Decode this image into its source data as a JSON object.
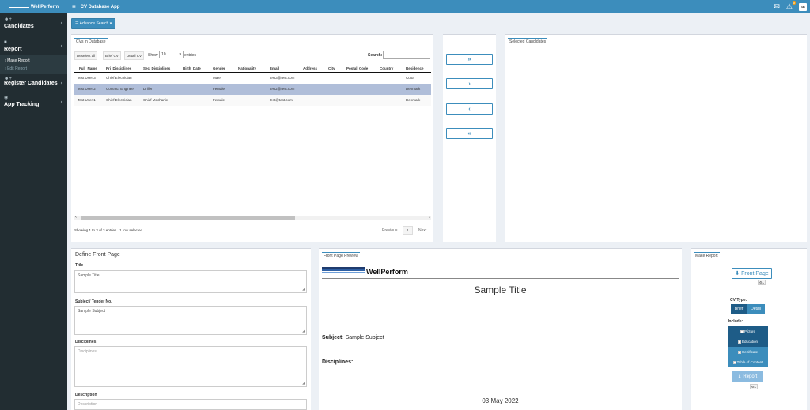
{
  "brand": {
    "logo_text": "WellPerform"
  },
  "header": {
    "app_title": "CV Database App",
    "notification_count": "0",
    "user_initials": "SB"
  },
  "sidebar": {
    "items": [
      {
        "label": "Candidates"
      },
      {
        "label": "Report",
        "subitems": [
          {
            "label": "Make Report"
          },
          {
            "label": "Edit Report"
          }
        ]
      },
      {
        "label": "Register Candidates"
      },
      {
        "label": "App Tracking"
      }
    ]
  },
  "toolbar": {
    "advance_search": "Advance Search"
  },
  "cv_database": {
    "tab": "CVs in Database",
    "deselect_all": "Deselect all",
    "brief_cv": "Brief CV",
    "detail_cv": "Detail CV",
    "show_label": "Show",
    "entries_value": "10",
    "entries_label": "entries",
    "search_label": "Search:",
    "columns": [
      "Full_Name",
      "Pri_Disciplines",
      "Sec_Disciplines",
      "Birth_Date",
      "Gender",
      "Nationality",
      "Email",
      "Address",
      "City",
      "Postal_Code",
      "Country",
      "Residence"
    ],
    "rows": [
      [
        "Test User 3",
        "Chief Electrician",
        "",
        "",
        "Male",
        "",
        "test3@test.com",
        "",
        "",
        "",
        "",
        "Cuba"
      ],
      [
        "Test User 2",
        "Contract Engineer",
        "Driller",
        "",
        "Female",
        "",
        "test2@test.com",
        "",
        "",
        "",
        "",
        "Denmark"
      ],
      [
        "Test User 1",
        "Chief Electrician",
        "Chief Mechanic",
        "",
        "Female",
        "",
        "test@test.com",
        "",
        "",
        "",
        "",
        "Denmark"
      ]
    ],
    "info": "Showing 1 to 3 of 3 entries",
    "selected_info": "1 row selected",
    "previous": "Previous",
    "page": "1",
    "next": "Next"
  },
  "transfer": {
    "add_all": "»",
    "add": "›",
    "remove": "‹",
    "remove_all": "«"
  },
  "selected_candidates": {
    "tab": "Selected Candidates"
  },
  "define_front_page": {
    "title": "Define Front Page",
    "fields": [
      {
        "label": "Title",
        "value": "Sample Title",
        "placeholder": ""
      },
      {
        "label": "Subject/ Tender No.",
        "value": "Sample Subject",
        "placeholder": ""
      },
      {
        "label": "Disciplines",
        "value": "",
        "placeholder": "Disciplines"
      },
      {
        "label": "Description",
        "value": "",
        "placeholder": "Description"
      }
    ]
  },
  "preview": {
    "tab": "Front Page Preview",
    "logo_text": "WellPerform",
    "title": "Sample Title",
    "subject_label": "Subject:",
    "subject_value": "Sample Subject",
    "disciplines_label": "Disciplines:",
    "date": "03 May 2022"
  },
  "make_report": {
    "tab": "Make Report",
    "front_page_button": "Front Page",
    "cv_type_label": "CV Type:",
    "cv_type_options": [
      "Brief",
      "Detail"
    ],
    "cv_type_selected": "Brief",
    "include_label": "Include:",
    "include_options": [
      {
        "label": "Picture",
        "checked": true
      },
      {
        "label": "Education",
        "checked": true
      },
      {
        "label": "Certificate",
        "checked": false
      },
      {
        "label": "Table of Content",
        "checked": false
      }
    ],
    "report_button": "Report"
  },
  "colors": {
    "primary": "#3c8dbc",
    "sidebar": "#222d32",
    "include_dark": "#1e5c87",
    "selected_row": "#b0bed9"
  }
}
